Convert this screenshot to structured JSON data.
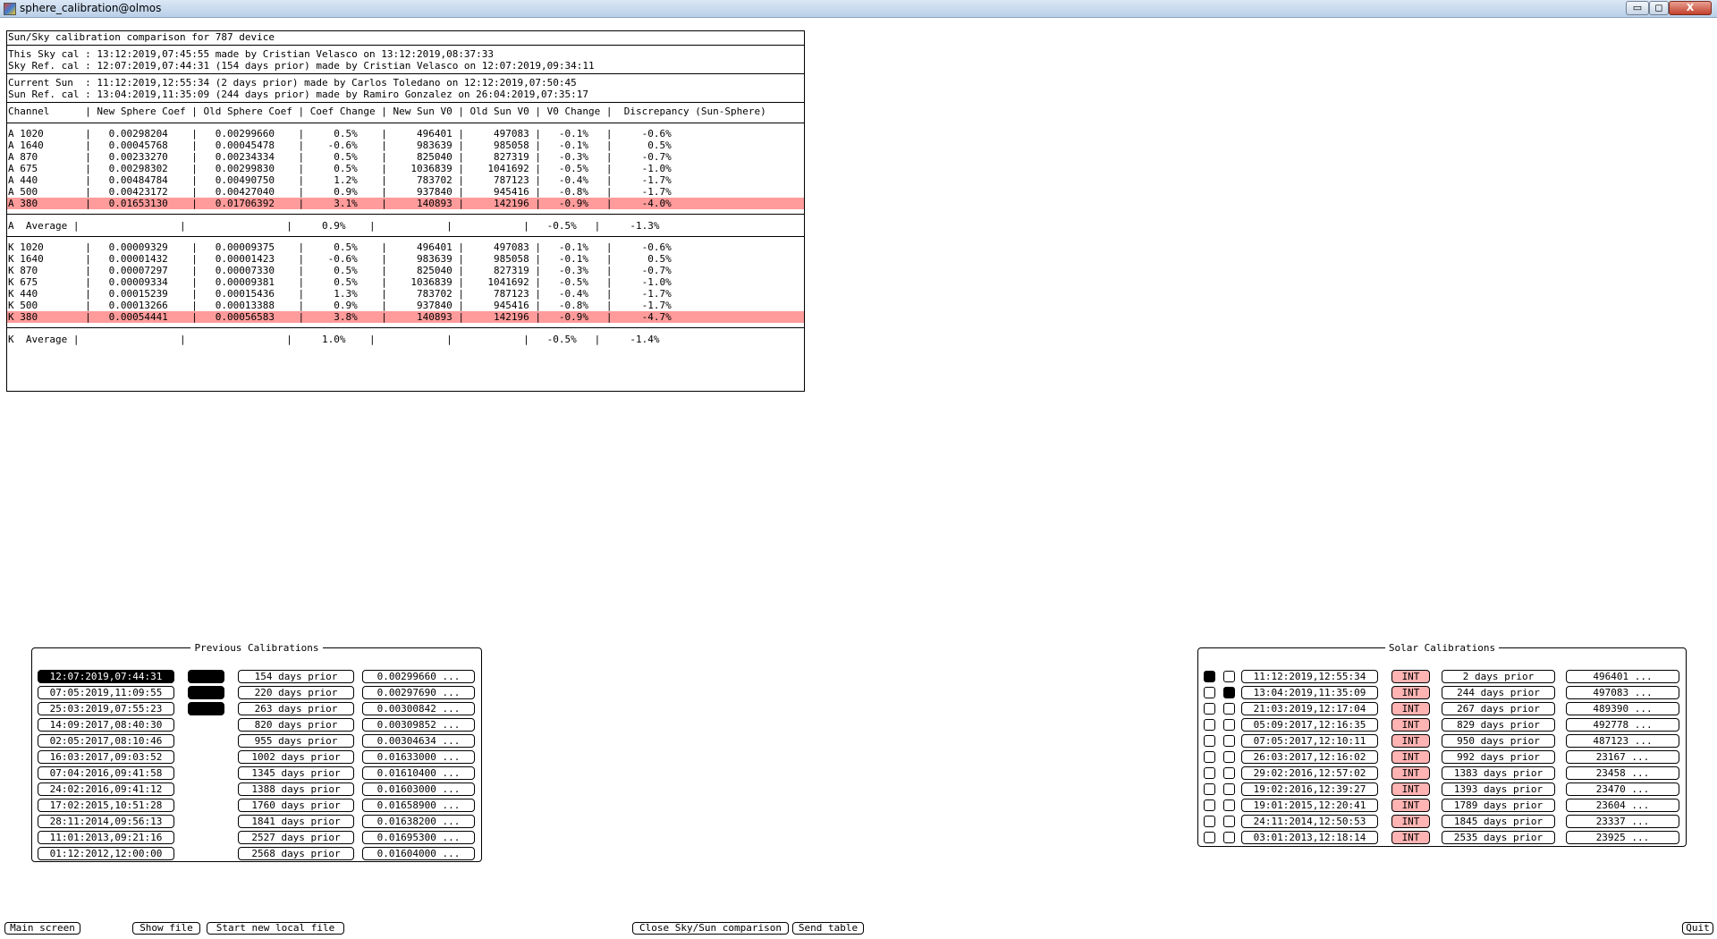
{
  "window": {
    "title": "sphere_calibration@olmos",
    "minimize_glyph": "▭",
    "maximize_glyph": "◻",
    "close_glyph": "X",
    "icon": "app-icon"
  },
  "report": {
    "title": "Sun/Sky calibration comparison for 787 device",
    "sky_lines": [
      "This Sky cal : 13:12:2019,07:45:55 made by Cristian Velasco on 13:12:2019,08:37:33",
      "Sky Ref. cal : 12:07:2019,07:44:31 (154 days prior) made by Cristian Velasco on 12:07:2019,09:34:11"
    ],
    "sun_lines": [
      "Current Sun  : 11:12:2019,12:55:34 (2 days prior) made by Carlos Toledano on 12:12:2019,07:50:45",
      "Sun Ref. cal : 13:04:2019,11:35:09 (244 days prior) made by Ramiro Gonzalez on 26:04:2019,07:35:17"
    ],
    "header": "Channel      | New Sphere Coef | Old Sphere Coef | Coef Change | New Sun V0 | Old Sun V0 | V0 Change |  Discrepancy (Sun-Sphere)",
    "a_rows": [
      {
        "text": "A 1020       |   0.00298204    |   0.00299660    |     0.5%    |     496401 |     497083 |   -0.1%   |     -0.6%",
        "hl": false
      },
      {
        "text": "A 1640       |   0.00045768    |   0.00045478    |    -0.6%    |     983639 |     985058 |   -0.1%   |      0.5%",
        "hl": false
      },
      {
        "text": "A 870        |   0.00233270    |   0.00234334    |     0.5%    |     825040 |     827319 |   -0.3%   |     -0.7%",
        "hl": false
      },
      {
        "text": "A 675        |   0.00298302    |   0.00299830    |     0.5%    |    1036839 |    1041692 |   -0.5%   |     -1.0%",
        "hl": false
      },
      {
        "text": "A 440        |   0.00484784    |   0.00490750    |     1.2%    |     783702 |     787123 |   -0.4%   |     -1.7%",
        "hl": false
      },
      {
        "text": "A 500        |   0.00423172    |   0.00427040    |     0.9%    |     937840 |     945416 |   -0.8%   |     -1.7%",
        "hl": false
      },
      {
        "text": "A 380        |   0.01653130    |   0.01706392    |     3.1%    |     140893 |     142196 |   -0.9%   |     -4.0%",
        "hl": true
      }
    ],
    "a_average": "A  Average |                 |                 |     0.9%    |            |            |   -0.5%   |     -1.3%",
    "k_rows": [
      {
        "text": "K 1020       |   0.00009329    |   0.00009375    |     0.5%    |     496401 |     497083 |   -0.1%   |     -0.6%",
        "hl": false
      },
      {
        "text": "K 1640       |   0.00001432    |   0.00001423    |    -0.6%    |     983639 |     985058 |   -0.1%   |      0.5%",
        "hl": false
      },
      {
        "text": "K 870        |   0.00007297    |   0.00007330    |     0.5%    |     825040 |     827319 |   -0.3%   |     -0.7%",
        "hl": false
      },
      {
        "text": "K 675        |   0.00009334    |   0.00009381    |     0.5%    |    1036839 |    1041692 |   -0.5%   |     -1.0%",
        "hl": false
      },
      {
        "text": "K 440        |   0.00015239    |   0.00015436    |     1.3%    |     783702 |     787123 |   -0.4%   |     -1.7%",
        "hl": false
      },
      {
        "text": "K 500        |   0.00013266    |   0.00013388    |     0.9%    |     937840 |     945416 |   -0.8%   |     -1.7%",
        "hl": false
      },
      {
        "text": "K 380        |   0.00054441    |   0.00056583    |     3.8%    |     140893 |     142196 |   -0.9%   |     -4.7%",
        "hl": true
      }
    ],
    "k_average": "K  Average |                 |                 |     1.0%    |            |            |   -0.5%   |     -1.4%"
  },
  "previous_calibrations": {
    "legend": "Previous Calibrations",
    "rows": [
      {
        "date": "12:07:2019,07:44:31",
        "selected": true,
        "marked": true,
        "prior": "154 days prior",
        "value": "0.00299660 ..."
      },
      {
        "date": "07:05:2019,11:09:55",
        "selected": false,
        "marked": true,
        "prior": "220 days prior",
        "value": "0.00297690 ..."
      },
      {
        "date": "25:03:2019,07:55:23",
        "selected": false,
        "marked": true,
        "prior": "263 days prior",
        "value": "0.00300842 ..."
      },
      {
        "date": "14:09:2017,08:40:30",
        "selected": false,
        "marked": false,
        "prior": "820 days prior",
        "value": "0.00309852 ..."
      },
      {
        "date": "02:05:2017,08:10:46",
        "selected": false,
        "marked": false,
        "prior": "955 days prior",
        "value": "0.00304634 ..."
      },
      {
        "date": "16:03:2017,09:03:52",
        "selected": false,
        "marked": false,
        "prior": "1002 days prior",
        "value": "0.01633000 ..."
      },
      {
        "date": "07:04:2016,09:41:58",
        "selected": false,
        "marked": false,
        "prior": "1345 days prior",
        "value": "0.01610400 ..."
      },
      {
        "date": "24:02:2016,09:41:12",
        "selected": false,
        "marked": false,
        "prior": "1388 days prior",
        "value": "0.01603000 ..."
      },
      {
        "date": "17:02:2015,10:51:28",
        "selected": false,
        "marked": false,
        "prior": "1760 days prior",
        "value": "0.01658900 ..."
      },
      {
        "date": "28:11:2014,09:56:13",
        "selected": false,
        "marked": false,
        "prior": "1841 days prior",
        "value": "0.01638200 ..."
      },
      {
        "date": "11:01:2013,09:21:16",
        "selected": false,
        "marked": false,
        "prior": "2527 days prior",
        "value": "0.01695300 ..."
      },
      {
        "date": "01:12:2012,12:00:00",
        "selected": false,
        "marked": false,
        "prior": "2568 days prior",
        "value": "0.01604000 ..."
      }
    ]
  },
  "solar_calibrations": {
    "legend": "Solar Calibrations",
    "rows": [
      {
        "check1": true,
        "check2": false,
        "date": "11:12:2019,12:55:34",
        "type": "INT",
        "prior": "2 days prior",
        "value": "496401 ..."
      },
      {
        "check1": false,
        "check2": true,
        "date": "13:04:2019,11:35:09",
        "type": "INT",
        "prior": "244 days prior",
        "value": "497083 ..."
      },
      {
        "check1": false,
        "check2": false,
        "date": "21:03:2019,12:17:04",
        "type": "INT",
        "prior": "267 days prior",
        "value": "489390 ..."
      },
      {
        "check1": false,
        "check2": false,
        "date": "05:09:2017,12:16:35",
        "type": "INT",
        "prior": "829 days prior",
        "value": "492778 ..."
      },
      {
        "check1": false,
        "check2": false,
        "date": "07:05:2017,12:10:11",
        "type": "INT",
        "prior": "950 days prior",
        "value": "487123 ..."
      },
      {
        "check1": false,
        "check2": false,
        "date": "26:03:2017,12:16:02",
        "type": "INT",
        "prior": "992 days prior",
        "value": "23167 ..."
      },
      {
        "check1": false,
        "check2": false,
        "date": "29:02:2016,12:57:02",
        "type": "INT",
        "prior": "1383 days prior",
        "value": "23458 ..."
      },
      {
        "check1": false,
        "check2": false,
        "date": "19:02:2016,12:39:27",
        "type": "INT",
        "prior": "1393 days prior",
        "value": "23470 ..."
      },
      {
        "check1": false,
        "check2": false,
        "date": "19:01:2015,12:20:41",
        "type": "INT",
        "prior": "1789 days prior",
        "value": "23604 ..."
      },
      {
        "check1": false,
        "check2": false,
        "date": "24:11:2014,12:50:53",
        "type": "INT",
        "prior": "1845 days prior",
        "value": "23337 ..."
      },
      {
        "check1": false,
        "check2": false,
        "date": "03:01:2013,12:18:14",
        "type": "INT",
        "prior": "2535 days prior",
        "value": "23925 ..."
      }
    ]
  },
  "bottom_bar": {
    "main_screen": "Main screen",
    "show_file": "Show file",
    "start_new_local_file": "Start new local file",
    "close_comparison": "Close Sky/Sun comparison",
    "send_table": "Send table",
    "quit": "Quit"
  },
  "colors": {
    "highlight_row": "#ff9b9b",
    "int_badge": "#ffb3b3"
  }
}
